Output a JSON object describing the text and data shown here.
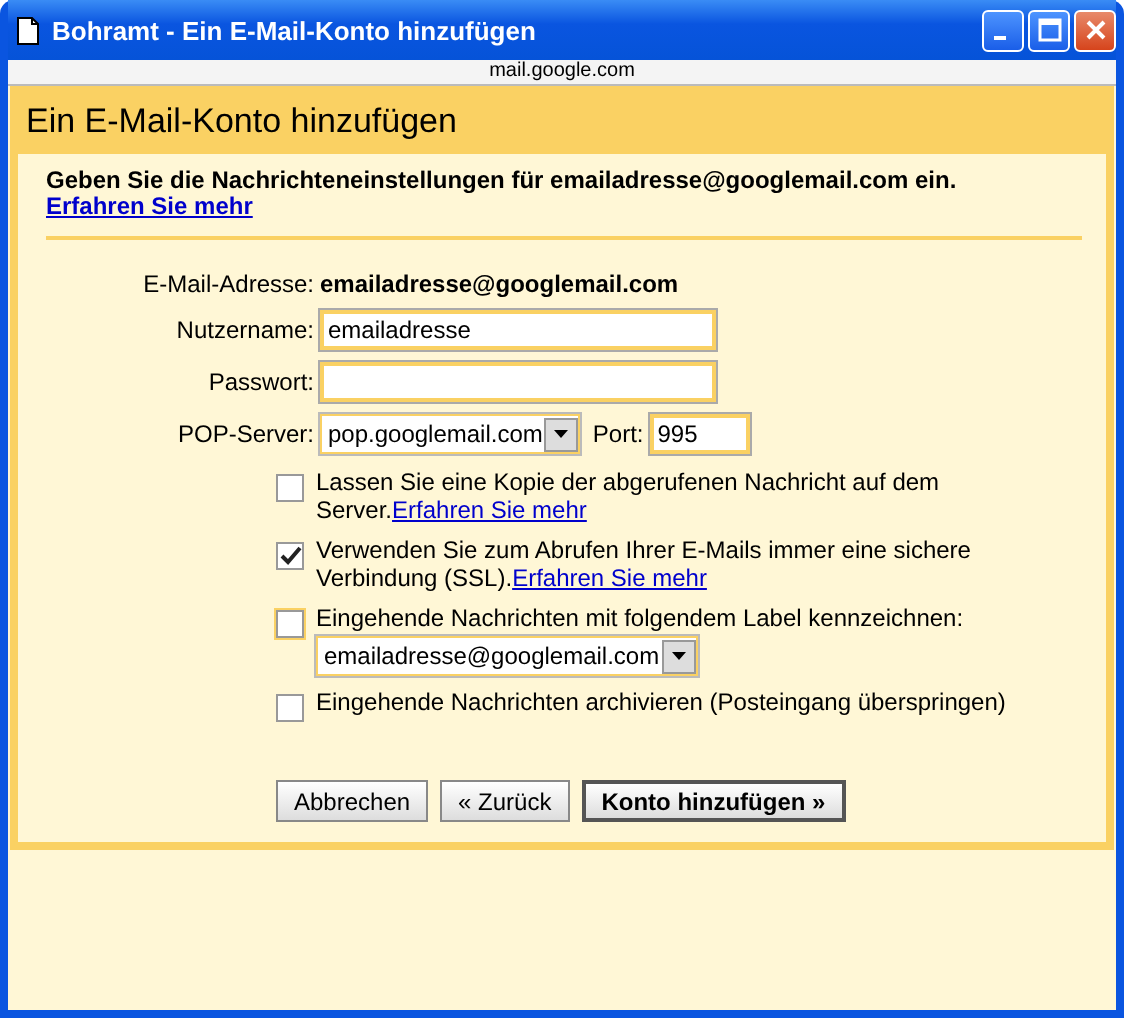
{
  "window": {
    "title": "Bohramt - Ein E-Mail-Konto hinzufügen"
  },
  "address_bar": {
    "url": "mail.google.com"
  },
  "dialog": {
    "heading": "Ein E-Mail-Konto hinzufügen",
    "intro": "Geben Sie die Nachrichteneinstellungen für emailadresse@googlemail.com ein.",
    "intro_link": "Erfahren Sie mehr",
    "fields": [
      {
        "kind": "static",
        "label": "E-Mail-Adresse:",
        "value": "emailadresse@googlemail.com"
      },
      {
        "kind": "text",
        "label": "Nutzername:",
        "value": "emailadresse"
      },
      {
        "kind": "password",
        "label": "Passwort:"
      },
      {
        "kind": "server",
        "label": "POP-Server:",
        "value": "pop.googlemail.com",
        "port_label": "Port:",
        "port": "995"
      }
    ],
    "options": [
      {
        "text": "Lassen Sie eine Kopie der abgerufenen Nachricht auf dem Server.",
        "link": "Erfahren Sie mehr",
        "checked": false,
        "focused": false
      },
      {
        "text": "Verwenden Sie zum Abrufen Ihrer E-Mails immer eine sichere Verbindung (SSL).",
        "link": "Erfahren Sie mehr",
        "checked": true,
        "focused": false
      },
      {
        "text": "Eingehende Nachrichten mit folgendem Label kennzeichnen:",
        "select": "emailadresse@googlemail.com",
        "checked": false,
        "focused": true
      },
      {
        "text": "Eingehende Nachrichten archivieren (Posteingang überspringen)",
        "checked": false,
        "focused": false
      }
    ],
    "buttons": [
      {
        "label": "Abbrechen",
        "primary": false
      },
      {
        "label": "« Zurück",
        "primary": false
      },
      {
        "label": "Konto hinzufügen »",
        "primary": true
      }
    ]
  }
}
